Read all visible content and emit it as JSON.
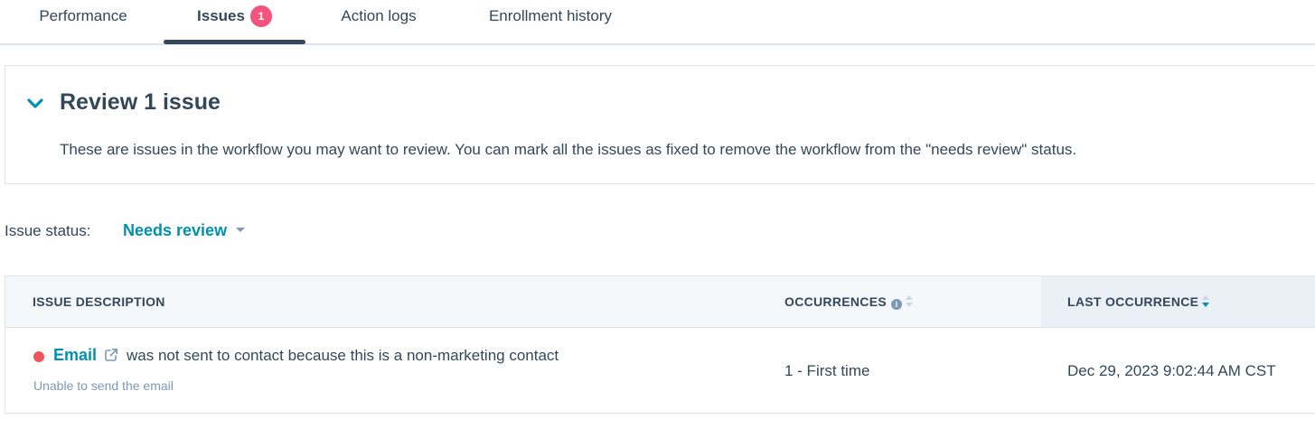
{
  "tabs": [
    {
      "label": "Performance"
    },
    {
      "label": "Issues",
      "badge": "1",
      "active": true
    },
    {
      "label": "Action logs"
    },
    {
      "label": "Enrollment history"
    }
  ],
  "review": {
    "title": "Review 1 issue",
    "description": "These are issues in the workflow you may want to review. You can mark all the issues as fixed to remove the workflow from the \"needs review\" status."
  },
  "filter": {
    "label": "Issue status:",
    "value": "Needs review"
  },
  "table": {
    "columns": [
      {
        "label": "ISSUE DESCRIPTION"
      },
      {
        "label": "OCCURRENCES"
      },
      {
        "label": "LAST OCCURRENCE"
      }
    ],
    "rows": [
      {
        "link": "Email",
        "text": "was not sent to contact because this is a non-marketing contact",
        "subtext": "Unable to send the email",
        "occurrences": "1 - First time",
        "last_occurrence": "Dec 29, 2023 9:02:44 AM CST"
      }
    ]
  },
  "colors": {
    "accent": "#0091ae",
    "badge": "#f2547d",
    "error_dot": "#f2545b",
    "text": "#33475b"
  }
}
